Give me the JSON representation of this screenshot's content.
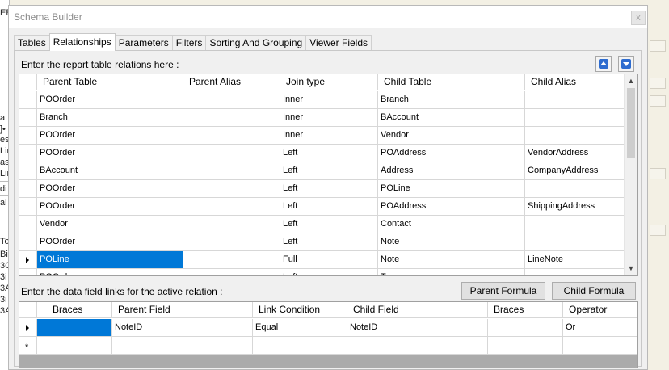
{
  "background_left": {
    "fragments": [
      "EE",
      "a",
      "]•",
      "es",
      "Lir",
      "as",
      "Lir",
      "di",
      "ai",
      "To",
      "Bi",
      "3C",
      "3i",
      "3A",
      "3i",
      "3A"
    ]
  },
  "dialog": {
    "title": "Schema Builder",
    "close_label": "x"
  },
  "tabs": [
    {
      "label": "Tables"
    },
    {
      "label": "Relationships"
    },
    {
      "label": "Parameters"
    },
    {
      "label": "Filters"
    },
    {
      "label": "Sorting And Grouping"
    },
    {
      "label": "Viewer Fields"
    }
  ],
  "relations": {
    "instruction": "Enter the report table relations here :",
    "columns": [
      "Parent Table",
      "Parent Alias",
      "Join type",
      "Child Table",
      "Child Alias"
    ],
    "rows": [
      [
        "POOrder",
        "",
        "Inner",
        "Branch",
        ""
      ],
      [
        "Branch",
        "",
        "Inner",
        "BAccount",
        ""
      ],
      [
        "POOrder",
        "",
        "Inner",
        "Vendor",
        ""
      ],
      [
        "POOrder",
        "",
        "Left",
        "POAddress",
        "VendorAddress"
      ],
      [
        "BAccount",
        "",
        "Left",
        "Address",
        "CompanyAddress"
      ],
      [
        "POOrder",
        "",
        "Left",
        "POLine",
        ""
      ],
      [
        "POOrder",
        "",
        "Left",
        "POAddress",
        "ShippingAddress"
      ],
      [
        "Vendor",
        "",
        "Left",
        "Contact",
        ""
      ],
      [
        "POOrder",
        "",
        "Left",
        "Note",
        ""
      ],
      [
        "POLine",
        "",
        "Full",
        "Note",
        "LineNote"
      ],
      [
        "POOrder",
        "",
        "Left",
        "Terms",
        ""
      ]
    ],
    "selected_row": 9
  },
  "links": {
    "instruction": "Enter the data field links for the active relation :",
    "parent_formula_label": "Parent Formula",
    "child_formula_label": "Child Formula",
    "columns": [
      "Braces",
      "Parent Field",
      "Link Condition",
      "Child Field",
      "Braces",
      "Operator"
    ],
    "rows": [
      [
        "",
        "NoteID",
        "Equal",
        "NoteID",
        "",
        "Or"
      ]
    ],
    "new_row_marker": "*"
  },
  "icons": {
    "move_up": "arrow-up-icon",
    "move_down": "arrow-down-icon",
    "current_row": "triangle-right-icon"
  },
  "colors": {
    "selection": "#0078d7",
    "arrow_button": "#2e6ccf"
  }
}
